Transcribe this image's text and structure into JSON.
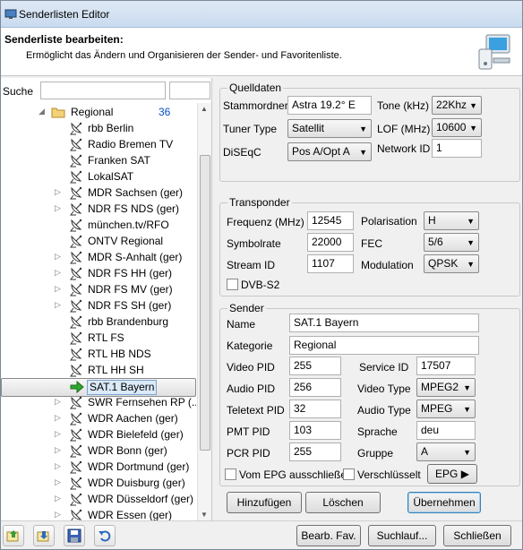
{
  "window": {
    "title": "Senderlisten Editor"
  },
  "header": {
    "title": "Senderliste bearbeiten:",
    "subtitle": "Ermöglicht das Ändern und Organisieren der Sender- und Favoritenliste."
  },
  "search": {
    "label": "Suche",
    "value": ""
  },
  "tree": {
    "group": {
      "label": "Regional",
      "count": "36"
    },
    "items": [
      {
        "label": "rbb Berlin",
        "expandable": false
      },
      {
        "label": "Radio Bremen TV",
        "expandable": false
      },
      {
        "label": "Franken SAT",
        "expandable": false
      },
      {
        "label": "LokalSAT",
        "expandable": false
      },
      {
        "label": "MDR Sachsen (ger)",
        "expandable": true
      },
      {
        "label": "NDR FS NDS (ger)",
        "expandable": true
      },
      {
        "label": "münchen.tv/RFO",
        "expandable": false
      },
      {
        "label": "ONTV Regional",
        "expandable": false
      },
      {
        "label": "MDR S-Anhalt (ger)",
        "expandable": true
      },
      {
        "label": "NDR FS HH (ger)",
        "expandable": true
      },
      {
        "label": "NDR FS MV (ger)",
        "expandable": true
      },
      {
        "label": "NDR FS SH (ger)",
        "expandable": true
      },
      {
        "label": "rbb Brandenburg",
        "expandable": false
      },
      {
        "label": "RTL FS",
        "expandable": false
      },
      {
        "label": "RTL HB NDS",
        "expandable": false
      },
      {
        "label": "RTL HH SH",
        "expandable": false
      },
      {
        "label": "SAT.1 Bayern",
        "expandable": true,
        "selected": true
      },
      {
        "label": "SWR Fernsehen RP (...",
        "expandable": true
      },
      {
        "label": "WDR Aachen (ger)",
        "expandable": true
      },
      {
        "label": "WDR Bielefeld (ger)",
        "expandable": true
      },
      {
        "label": "WDR Bonn (ger)",
        "expandable": true
      },
      {
        "label": "WDR Dortmund (ger)",
        "expandable": true
      },
      {
        "label": "WDR Duisburg (ger)",
        "expandable": true
      },
      {
        "label": "WDR Düsseldorf (ger)",
        "expandable": true
      },
      {
        "label": "WDR Essen (ger)",
        "expandable": true
      }
    ]
  },
  "quelldaten": {
    "legend": "Quelldaten",
    "stammordner_label": "Stammordner",
    "stammordner_value": "Astra 19.2° E",
    "tuner_label": "Tuner Type",
    "tuner_value": "Satellit",
    "diseqc_label": "DiSEqC",
    "diseqc_value": "Pos A/Opt A",
    "tone_label": "Tone (kHz)",
    "tone_value": "22Khz",
    "lof_label": "LOF  (MHz)",
    "lof_value": "10600",
    "network_label": "Network ID",
    "network_value": "1"
  },
  "transponder": {
    "legend": "Transponder",
    "freq_label": "Frequenz (MHz)",
    "freq_value": "12545",
    "symbol_label": "Symbolrate",
    "symbol_value": "22000",
    "stream_label": "Stream ID",
    "stream_value": "1107",
    "dvbs2_label": "DVB-S2",
    "pol_label": "Polarisation",
    "pol_value": "H",
    "fec_label": "FEC",
    "fec_value": "5/6",
    "mod_label": "Modulation",
    "mod_value": "QPSK"
  },
  "sender": {
    "legend": "Sender",
    "name_label": "Name",
    "name_value": "SAT.1 Bayern",
    "kategorie_label": "Kategorie",
    "kategorie_value": "Regional",
    "video_pid_label": "Video PID",
    "video_pid_value": "255",
    "audio_pid_label": "Audio PID",
    "audio_pid_value": "256",
    "teletext_pid_label": "Teletext PID",
    "teletext_pid_value": "32",
    "pmt_pid_label": "PMT PID",
    "pmt_pid_value": "103",
    "pcr_pid_label": "PCR PID",
    "pcr_pid_value": "255",
    "service_id_label": "Service ID",
    "service_id_value": "17507",
    "video_type_label": "Video Type",
    "video_type_value": "MPEG2",
    "audio_type_label": "Audio Type",
    "audio_type_value": "MPEG",
    "sprache_label": "Sprache",
    "sprache_value": "deu",
    "gruppe_label": "Gruppe",
    "gruppe_value": "A",
    "epg_check_label": "Vom EPG ausschließe",
    "verschluesselt_label": "Verschlüsselt",
    "epg_button": "EPG"
  },
  "actions": {
    "add": "Hinzufügen",
    "delete": "Löschen",
    "apply": "Übernehmen"
  },
  "footer": {
    "bearb_fav": "Bearb. Fav.",
    "suchlauf": "Suchlauf...",
    "close": "Schließen"
  }
}
